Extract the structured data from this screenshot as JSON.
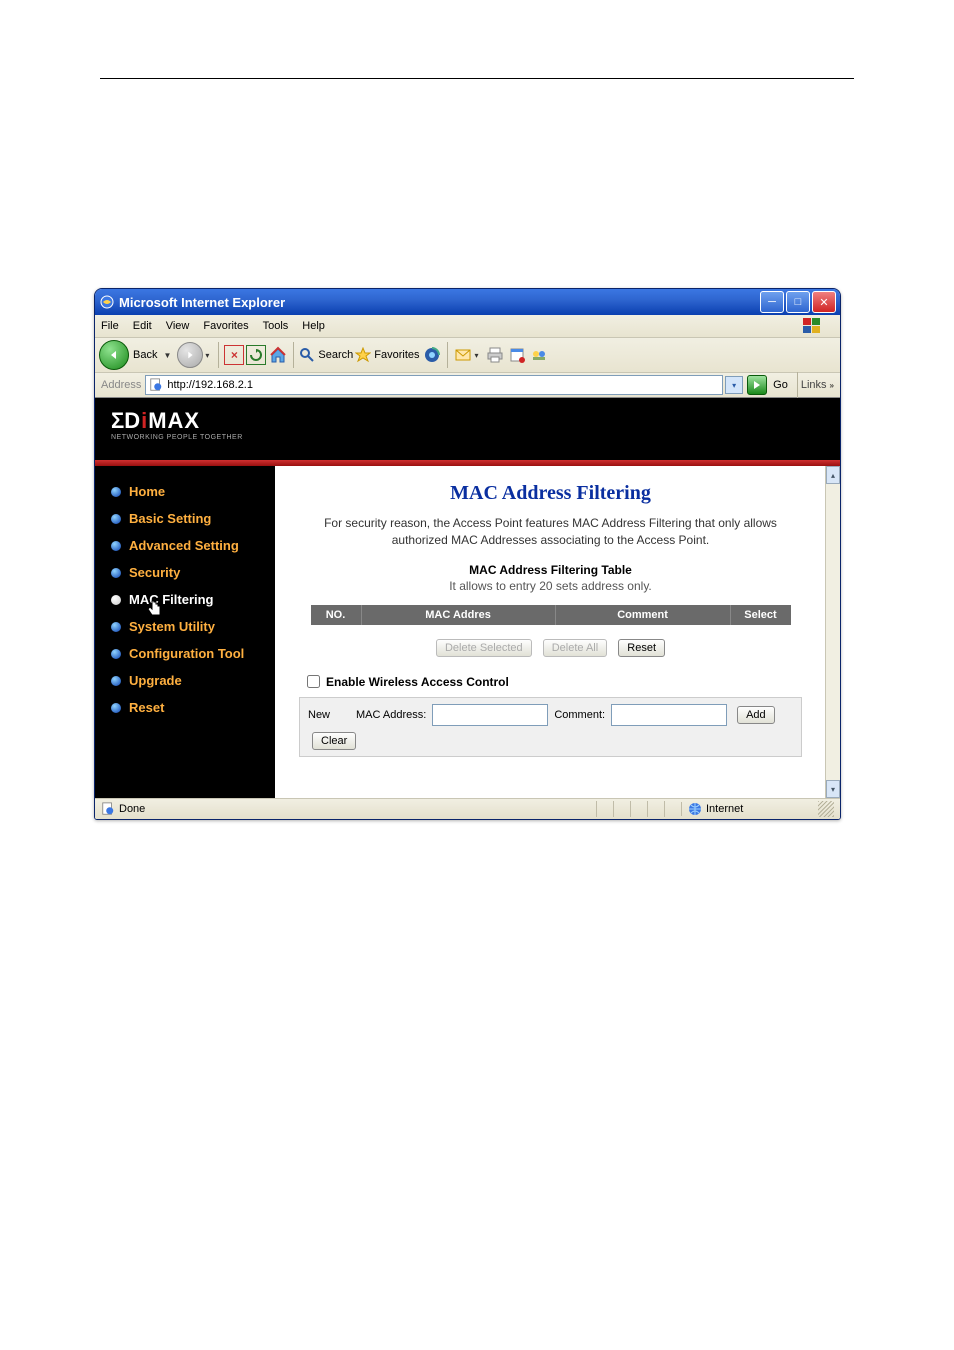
{
  "window": {
    "title": "Microsoft Internet Explorer"
  },
  "menubar": {
    "items": [
      "File",
      "Edit",
      "View",
      "Favorites",
      "Tools",
      "Help"
    ]
  },
  "toolbar": {
    "back": "Back",
    "search": "Search",
    "favorites": "Favorites"
  },
  "addressbar": {
    "label": "Address",
    "url": "http://192.168.2.1",
    "go": "Go",
    "links": "Links"
  },
  "brand": {
    "logo": "EDIMAX",
    "tagline": "NETWORKING PEOPLE TOGETHER"
  },
  "sidebar": {
    "items": [
      {
        "label": "Home"
      },
      {
        "label": "Basic Setting"
      },
      {
        "label": "Advanced Setting"
      },
      {
        "label": "Security"
      },
      {
        "label": "MAC Filtering"
      },
      {
        "label": "System Utility"
      },
      {
        "label": "Configuration Tool"
      },
      {
        "label": "Upgrade"
      },
      {
        "label": "Reset"
      }
    ],
    "active_index": 4
  },
  "main": {
    "heading": "MAC Address Filtering",
    "description": "For security reason, the Access Point features MAC Address Filtering that only allows authorized MAC Addresses associating to the Access Point.",
    "table_title": "MAC Address Filtering Table",
    "limit_note": "It allows to entry 20 sets address only.",
    "columns": {
      "no": "NO.",
      "addr": "MAC Addres",
      "comment": "Comment",
      "select": "Select"
    },
    "buttons": {
      "delete_selected": "Delete Selected",
      "delete_all": "Delete All",
      "reset": "Reset"
    },
    "enable_label": "Enable Wireless Access Control",
    "new_row": {
      "label": "New",
      "mac_label": "MAC Address:",
      "comment_label": "Comment:",
      "add": "Add",
      "clear": "Clear"
    }
  },
  "statusbar": {
    "done": "Done",
    "zone": "Internet"
  }
}
